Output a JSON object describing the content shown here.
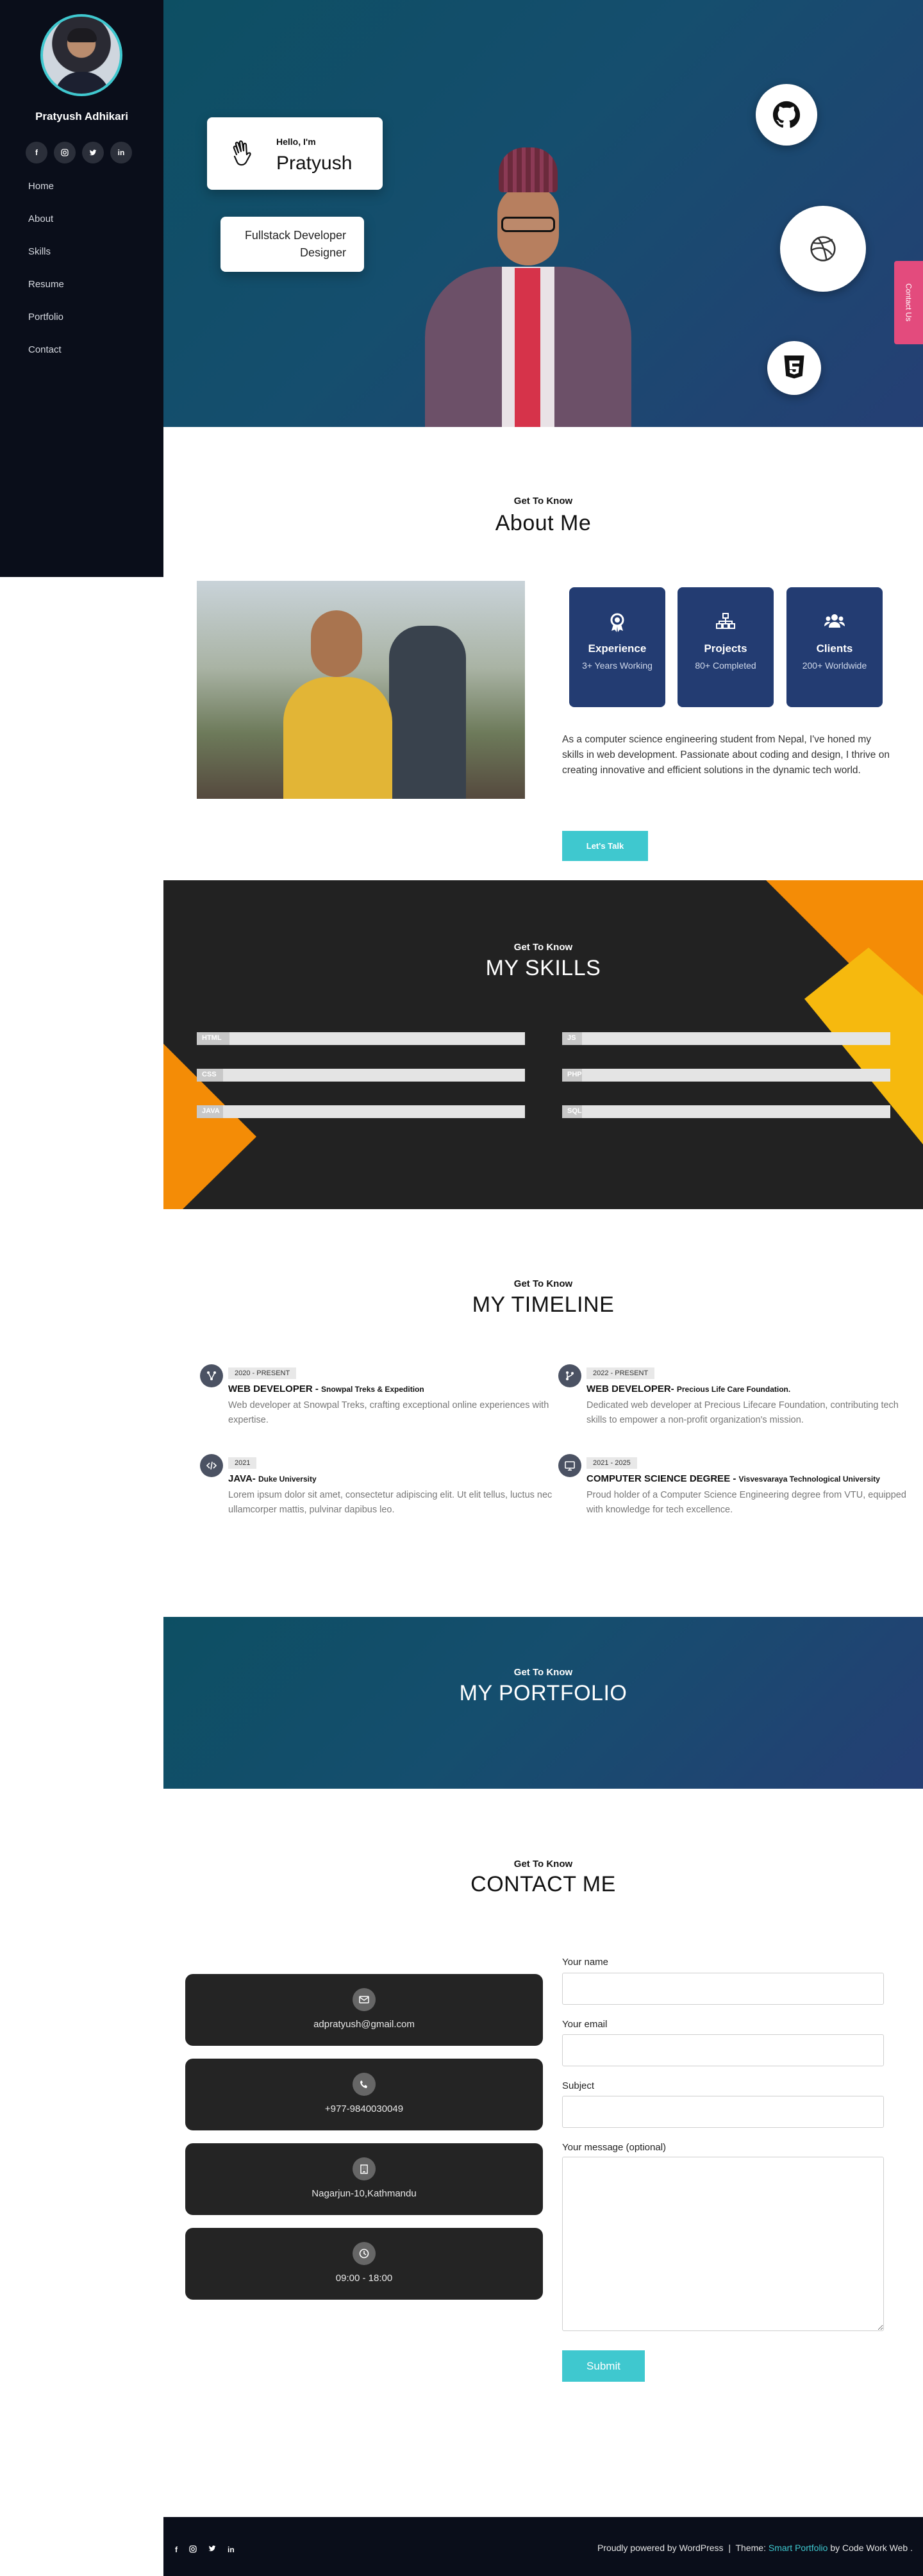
{
  "sidebar": {
    "name": "Pratyush Adhikari",
    "social": [
      "f",
      "ig",
      "tw",
      "in"
    ],
    "nav": [
      "Home",
      "About",
      "Skills",
      "Resume",
      "Portfolio",
      "Contact"
    ]
  },
  "hero": {
    "hello": "Hello, I'm",
    "name": "Pratyush",
    "role_line1": "Fullstack Developer",
    "role_line2": "Designer",
    "contact_tab": "Contact Us",
    "icons": [
      "github-icon",
      "dribbble-icon",
      "html5-icon"
    ]
  },
  "about": {
    "kicker": "Get To Know",
    "title": "About Me",
    "stats": [
      {
        "icon": "award-icon",
        "title": "Experience",
        "sub": "3+ Years Working"
      },
      {
        "icon": "sitemap-icon",
        "title": "Projects",
        "sub": "80+ Completed"
      },
      {
        "icon": "users-icon",
        "title": "Clients",
        "sub": "200+ Worldwide"
      }
    ],
    "text": "As a computer science engineering student from Nepal, I've honed my skills in web development. Passionate about coding and design, I thrive on creating innovative and efficient solutions in the dynamic tech world.",
    "button": "Let's Talk"
  },
  "skills": {
    "kicker": "Get To Know",
    "title": "MY SKILLS",
    "bar_color": "#c8c8c8",
    "items": [
      {
        "label": "HTML",
        "value": 10
      },
      {
        "label": "CSS",
        "value": 8
      },
      {
        "label": "JAVA",
        "value": 8
      },
      {
        "label": "JS",
        "value": 6
      },
      {
        "label": "PHP",
        "value": 6
      },
      {
        "label": "SQL",
        "value": 6
      }
    ]
  },
  "timeline": {
    "kicker": "Get To Know",
    "title": "MY TIMELINE",
    "items": [
      {
        "icon": "network-icon",
        "date": "2020 - PRESENT",
        "title": "WEB DEVELOPER - ",
        "org": "Snowpal Treks & Expedition",
        "desc": "Web developer at Snowpal Treks, crafting exceptional online experiences with expertise."
      },
      {
        "icon": "branch-icon",
        "date": "2022 - PRESENT",
        "title": "WEB DEVELOPER- ",
        "org": "Precious Life Care Foundation.",
        "desc": "Dedicated web developer at Precious Lifecare Foundation, contributing tech skills to empower a non-profit organization's mission."
      },
      {
        "icon": "code-icon",
        "date": "2021",
        "title": "JAVA- ",
        "org": "Duke University",
        "desc": "Lorem ipsum dolor sit amet, consectetur adipiscing elit. Ut elit tellus, luctus nec ullamcorper mattis, pulvinar dapibus leo."
      },
      {
        "icon": "monitor-icon",
        "date": "2021 - 2025",
        "title": "COMPUTER SCIENCE DEGREE - ",
        "org": "Visvesvaraya Technological University",
        "desc": "Proud holder of a Computer Science Engineering degree from VTU, equipped with knowledge for tech excellence."
      }
    ]
  },
  "portfolio": {
    "kicker": "Get To Know",
    "title": "MY PORTFOLIO"
  },
  "contact": {
    "kicker": "Get To Know",
    "title": "CONTACT ME",
    "cards": [
      {
        "icon": "mail-icon",
        "text": "adpratyush@gmail.com"
      },
      {
        "icon": "phone-icon",
        "text": "+977-9840030049"
      },
      {
        "icon": "building-icon",
        "text": "Nagarjun-10,Kathmandu"
      },
      {
        "icon": "clock-icon",
        "text": "09:00 - 18:00"
      }
    ],
    "form": {
      "name_label": "Your name",
      "email_label": "Your email",
      "subject_label": "Subject",
      "message_label": "Your message (optional)",
      "submit": "Submit"
    }
  },
  "footer": {
    "powered": "Proudly powered by WordPress",
    "separator": "|",
    "theme_prefix": "Theme:",
    "theme_link": "Smart Portfolio",
    "theme_suffix": "by Code Work Web .",
    "social": [
      "f",
      "ig",
      "tw",
      "in"
    ]
  },
  "colors": {
    "accent": "#3fc8cf",
    "sidebar": "#0a0e1a",
    "stat_card": "#233c72",
    "contact_tab": "#e34b7d",
    "orange": "#f48c06",
    "yellow": "#f6b90e"
  }
}
